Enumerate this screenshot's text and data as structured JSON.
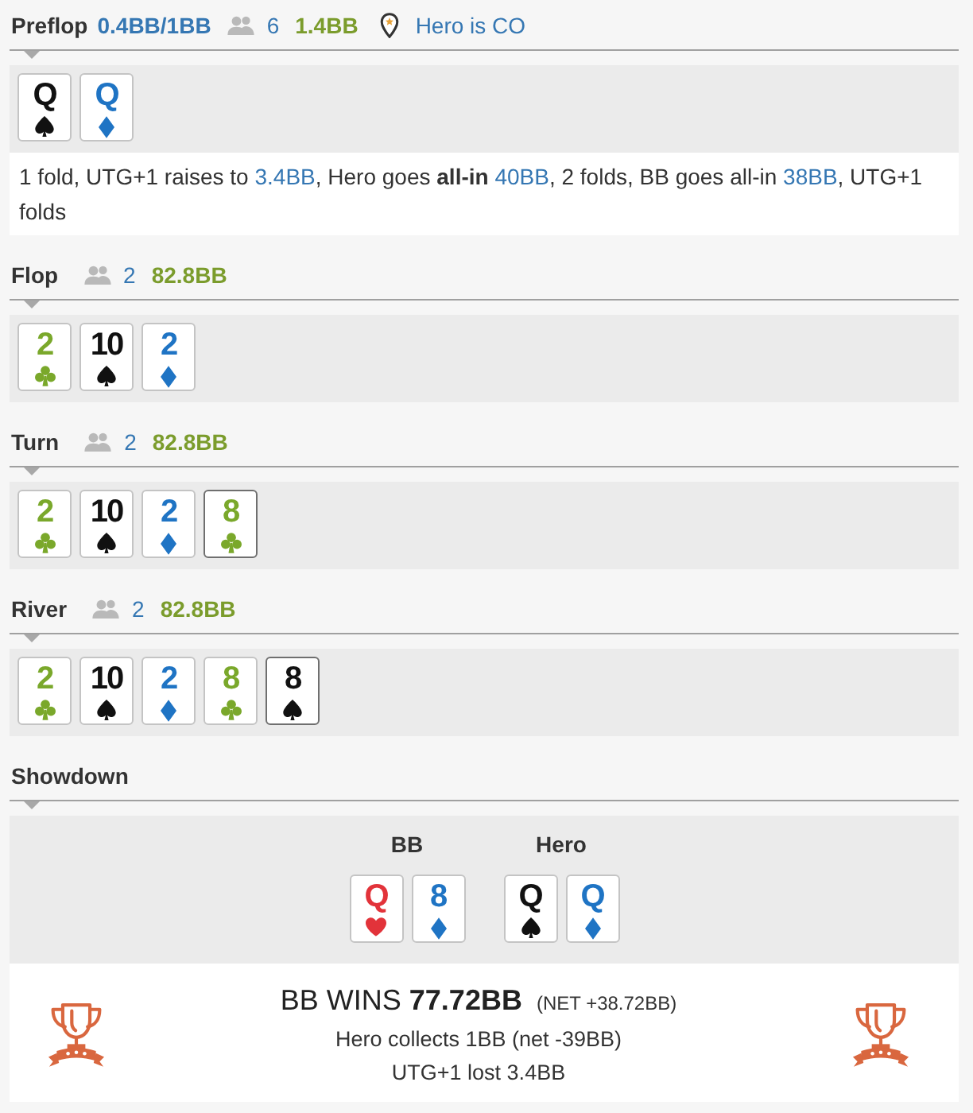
{
  "streets": [
    {
      "kind": "preflop",
      "name": "Preflop",
      "blinds": "0.4BB/1BB",
      "players": "6",
      "pot": "1.4BB",
      "position": "Hero is CO",
      "cards": [
        {
          "rank": "Q",
          "kind": "spades"
        },
        {
          "rank": "Q",
          "kind": "diamonds"
        }
      ],
      "action": [
        {
          "kind": "text",
          "text": "1 fold, UTG+1 raises to "
        },
        {
          "kind": "amount",
          "text": "3.4BB"
        },
        {
          "kind": "text",
          "text": ", Hero goes "
        },
        {
          "kind": "strong",
          "text": "all-in "
        },
        {
          "kind": "amount",
          "text": "40BB"
        },
        {
          "kind": "text",
          "text": ", 2 folds, BB goes all-in "
        },
        {
          "kind": "amount",
          "text": "38BB"
        },
        {
          "kind": "text",
          "text": ", UTG+1 folds"
        }
      ]
    },
    {
      "kind": "board",
      "name": "Flop",
      "players": "2",
      "pot": "82.8BB",
      "cards": [
        {
          "rank": "2",
          "kind": "clubs",
          "new": false
        },
        {
          "rank": "10",
          "kind": "spades",
          "new": false
        },
        {
          "rank": "2",
          "kind": "diamonds",
          "new": false
        }
      ]
    },
    {
      "kind": "board",
      "name": "Turn",
      "players": "2",
      "pot": "82.8BB",
      "cards": [
        {
          "rank": "2",
          "kind": "clubs",
          "new": false
        },
        {
          "rank": "10",
          "kind": "spades",
          "new": false
        },
        {
          "rank": "2",
          "kind": "diamonds",
          "new": false
        },
        {
          "rank": "8",
          "kind": "clubs",
          "new": true
        }
      ]
    },
    {
      "kind": "board",
      "name": "River",
      "players": "2",
      "pot": "82.8BB",
      "cards": [
        {
          "rank": "2",
          "kind": "clubs",
          "new": false
        },
        {
          "rank": "10",
          "kind": "spades",
          "new": false
        },
        {
          "rank": "2",
          "kind": "diamonds",
          "new": false
        },
        {
          "rank": "8",
          "kind": "clubs",
          "new": false
        },
        {
          "rank": "8",
          "kind": "spades",
          "new": true
        }
      ]
    }
  ],
  "showdown": {
    "title": "Showdown",
    "hands": [
      {
        "player": "BB",
        "cards": [
          {
            "rank": "Q",
            "kind": "hearts"
          },
          {
            "rank": "8",
            "kind": "diamonds"
          }
        ]
      },
      {
        "player": "Hero",
        "cards": [
          {
            "rank": "Q",
            "kind": "spades"
          },
          {
            "rank": "Q",
            "kind": "diamonds"
          }
        ]
      }
    ],
    "result": {
      "headline": "BB WINS **77.72BB**",
      "net": "(NET +38.72BB)",
      "lines": [
        "Hero collects 1BB (net -39BB)",
        "UTG+1 lost 3.4BB"
      ]
    }
  }
}
